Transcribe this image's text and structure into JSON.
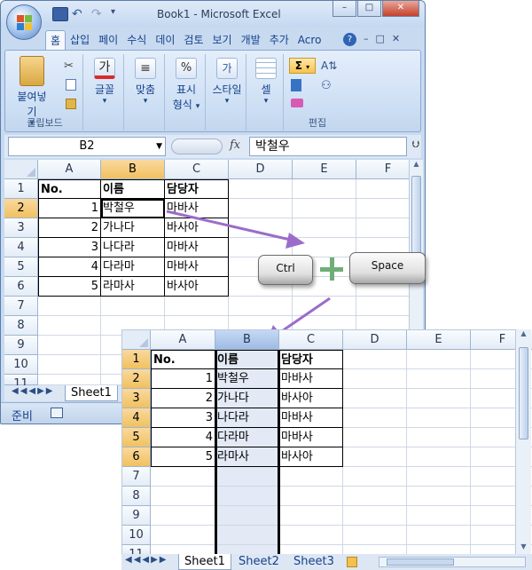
{
  "window": {
    "title": "Book1 - Microsoft Excel"
  },
  "ribbon_tabs": [
    "홈",
    "삽입",
    "페이",
    "수식",
    "데이",
    "검토",
    "보기",
    "개발",
    "추가",
    "Acro"
  ],
  "ribbon": {
    "paste": "붙여넣기",
    "clipboard_group": "클립보드",
    "font": "글꼴",
    "align": "맞춤",
    "number_line1": "표시",
    "number_line2": "형식",
    "style": "스타일",
    "cells": "셀",
    "edit_group": "편집"
  },
  "formula_bar": {
    "name_box": "B2",
    "fx": "fx",
    "value": "박철우"
  },
  "columns": [
    "A",
    "B",
    "C",
    "D",
    "E",
    "F"
  ],
  "rows": [
    "1",
    "2",
    "3",
    "4",
    "5",
    "6",
    "7",
    "8",
    "9",
    "10",
    "11"
  ],
  "table": {
    "header": [
      "No.",
      "이름",
      "담당자"
    ],
    "rows": [
      [
        "1",
        "박철우",
        "마바사"
      ],
      [
        "2",
        "가나다",
        "바사아"
      ],
      [
        "3",
        "나다라",
        "마바사"
      ],
      [
        "4",
        "다라마",
        "마바사"
      ],
      [
        "5",
        "라마사",
        "바사아"
      ]
    ]
  },
  "sheets_main": [
    "Sheet1"
  ],
  "sheets_zoom": [
    "Sheet1",
    "Sheet2",
    "Sheet3"
  ],
  "status": "준비",
  "keys": {
    "ctrl": "Ctrl",
    "space": "Space"
  },
  "colors": {
    "arrow": "#9b6dc9",
    "plus": "#6fae77",
    "selected_header": "#f1c15f"
  }
}
